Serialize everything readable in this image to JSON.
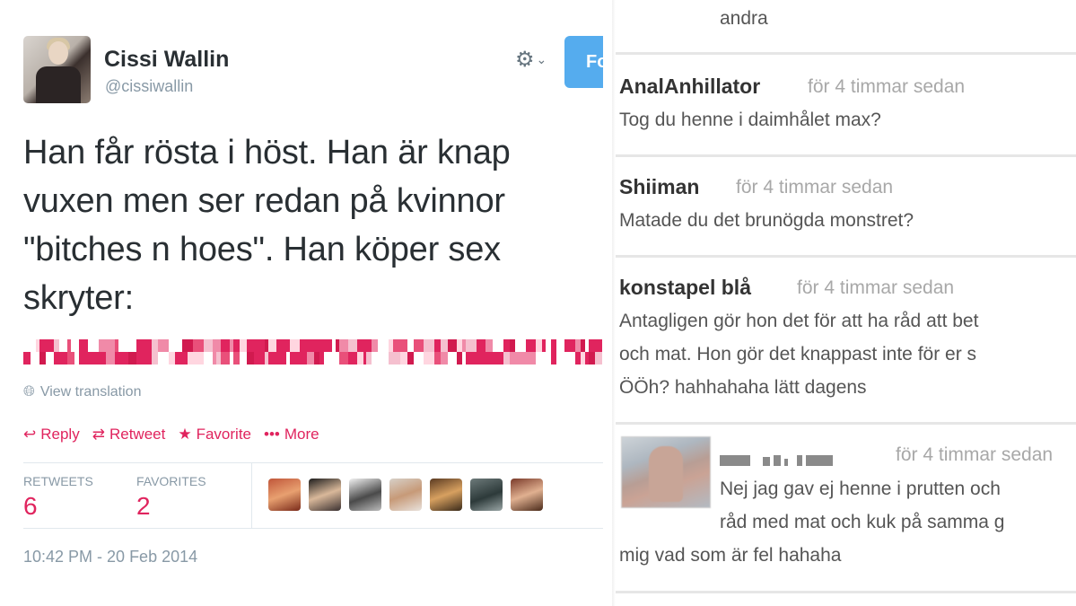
{
  "tweet": {
    "name": "Cissi Wallin",
    "handle": "@cissiwallin",
    "follow_label": "Fo",
    "text_lines": [
      "Han får rösta i höst. Han är knap",
      "vuxen men ser redan på kvinnor",
      "\"bitches n hoes\". Han köper sex",
      "skryter:"
    ],
    "view_translation": "View translation",
    "actions": {
      "reply": "Reply",
      "retweet": "Retweet",
      "favorite": "Favorite",
      "more": "More"
    },
    "stats": {
      "retweets_label": "RETWEETS",
      "retweets_value": "6",
      "favorites_label": "FAVORITES",
      "favorites_value": "2"
    },
    "timestamp": "10:42 PM - 20 Feb 2014",
    "icons": {
      "gear": "gear-icon",
      "globe": "globe-icon",
      "reply": "reply-icon",
      "retweet": "retweet-icon",
      "favorite": "star-icon",
      "more": "more-icon"
    },
    "colors": {
      "accent": "#e0245e",
      "follow": "#55acee",
      "muted": "#8899a6"
    }
  },
  "comments": {
    "top_fragment": "andra",
    "items": [
      {
        "author": "AnalAnhillator",
        "time": "för 4 timmar sedan",
        "body": [
          "Tog du henne i daimhålet max?"
        ]
      },
      {
        "author": "Shiiman",
        "time": "för 4 timmar sedan",
        "body": [
          "Matade du det brunögda monstret?"
        ]
      },
      {
        "author": "konstapel blå",
        "time": "för 4 timmar sedan",
        "body": [
          "Antagligen gör hon det för att ha råd att bet",
          "och mat. Hon gör det knappast inte för er s",
          "ÖÖh? hahhahaha lätt dagens"
        ]
      },
      {
        "author": "",
        "time": "för 4 timmar sedan",
        "body": [
          "Nej jag gav ej henne i prutten och",
          "råd med mat och kuk på samma g",
          "mig vad som är fel hahaha"
        ]
      }
    ]
  }
}
